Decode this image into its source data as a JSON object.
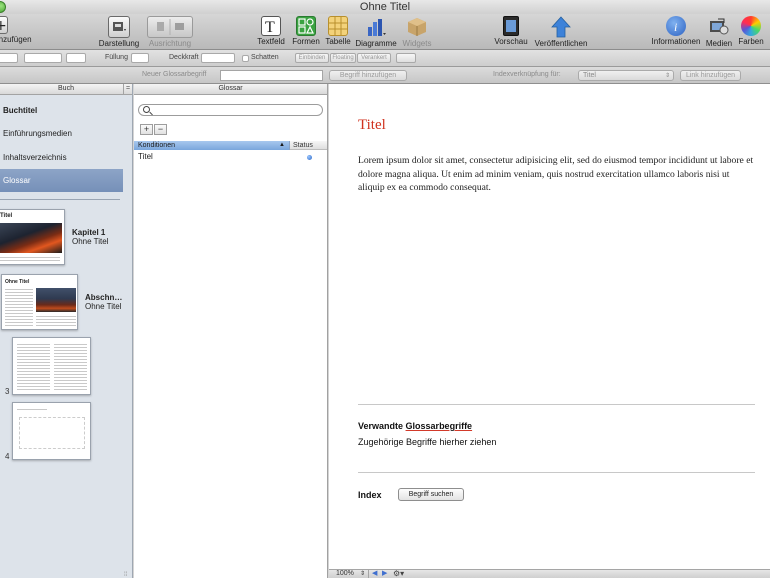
{
  "window": {
    "title": "Ohne Titel"
  },
  "toolbar": {
    "hinzufuegen": "hinzufügen",
    "darstellung": "Darstellung",
    "ausrichtung": "Ausrichtung",
    "textfeld": "Textfeld",
    "formen": "Formen",
    "tabelle": "Tabelle",
    "diagramme": "Diagramme",
    "widgets": "Widgets",
    "vorschau": "Vorschau",
    "veroeffentlichen": "Veröffentlichen",
    "informationen": "Informationen",
    "medien": "Medien",
    "farben": "Farben"
  },
  "formatbar": {
    "fuellung": "Füllung",
    "deckkraft": "Deckkraft",
    "schatten": "Schatten",
    "einbinden": "Einbinden",
    "floating": "Floating",
    "verankert": "Verankert"
  },
  "glossbar": {
    "neuer_begriff_label": "Neuer Glossarbegriff",
    "begriff_hinzufuegen": "Begriff hinzufügen",
    "indexverknuepfung_label": "Indexverknüpfung für:",
    "selected_term": "Titel",
    "link_hinzufuegen": "Link hinzufügen"
  },
  "sidebar": {
    "header": "Buch",
    "items": [
      {
        "label": "Buchtitel"
      },
      {
        "label": "Einführungsmedien"
      },
      {
        "label": "Inhaltsverzeichnis"
      },
      {
        "label": "Glossar"
      }
    ],
    "pages": [
      {
        "title": "Kapitel 1",
        "subtitle": "Ohne Titel",
        "thumb_title": "Titel"
      },
      {
        "title": "Abschn…",
        "subtitle": "Ohne Titel",
        "thumb_title": "Ohne Titel"
      },
      {
        "number": "3"
      },
      {
        "number": "4"
      }
    ]
  },
  "glossary": {
    "header": "Glossar",
    "add_label": "+",
    "remove_label": "−",
    "columns": {
      "conditions": "Konditionen",
      "status": "Status"
    },
    "rows": [
      {
        "term": "Titel"
      }
    ]
  },
  "document": {
    "title": "Titel",
    "body": "Lorem ipsum dolor sit amet, consectetur adipisicing elit, sed do eiusmod tempor incididunt ut labore et dolore magna aliqua. Ut enim ad minim veniam, quis nostrud exercitation ullamco laboris nisi ut aliquip ex ea commodo consequat.",
    "related_heading_prefix": "Verwandte",
    "related_heading_term": "Glossarbegriffe",
    "related_hint": "Zugehörige Begriffe hierher ziehen",
    "index_heading": "Index",
    "search_term_button": "Begriff suchen"
  },
  "statusbar": {
    "zoom": "100%"
  },
  "colors": {
    "accent_title": "#d0321f",
    "selection": "#7f98be"
  }
}
